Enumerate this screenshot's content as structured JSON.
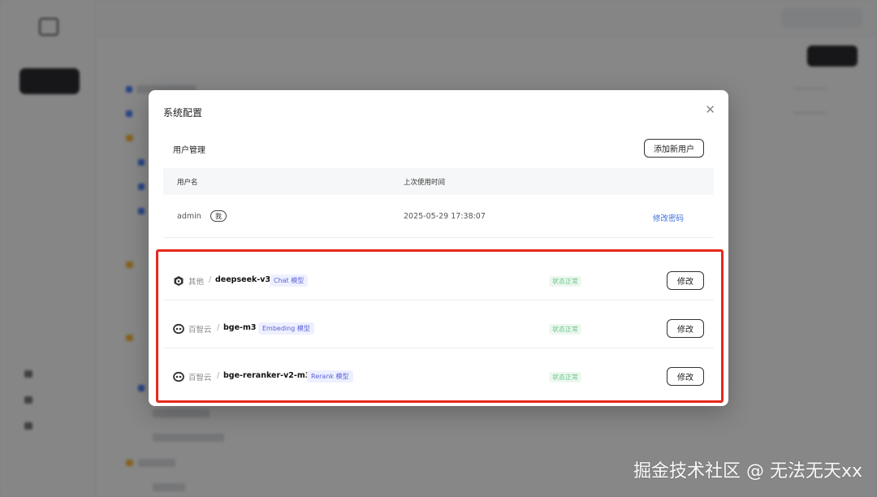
{
  "modal": {
    "title": "系统配置",
    "close_icon": "close-icon"
  },
  "user_management": {
    "title": "用户管理",
    "add_user_label": "添加新用户",
    "columns": [
      "用户名",
      "上次使用时间"
    ],
    "users": [
      {
        "name": "admin",
        "tag": "我",
        "last_used": "2025-05-29 17:38:07",
        "action": "修改密码"
      }
    ]
  },
  "models": [
    {
      "icon": "cube-icon",
      "provider": "其他",
      "name": "deepseek-v3",
      "tag": "Chat 模型",
      "status": "状态正常",
      "action": "修改"
    },
    {
      "icon": "baidu-icon",
      "provider": "百智云",
      "name": "bge-m3",
      "tag": "Embeding 模型",
      "status": "状态正常",
      "action": "修改"
    },
    {
      "icon": "baidu-icon",
      "provider": "百智云",
      "name": "bge-reranker-v2-m3",
      "tag": "Rerank 模型",
      "status": "状态正常",
      "action": "修改"
    }
  ],
  "watermark": "掘金技术社区 @ 无法无天xx",
  "colors": {
    "highlight": "#e8281d",
    "link": "#3b6fe0",
    "tag_text": "#5b62d8",
    "status_text": "#6cc48a"
  }
}
